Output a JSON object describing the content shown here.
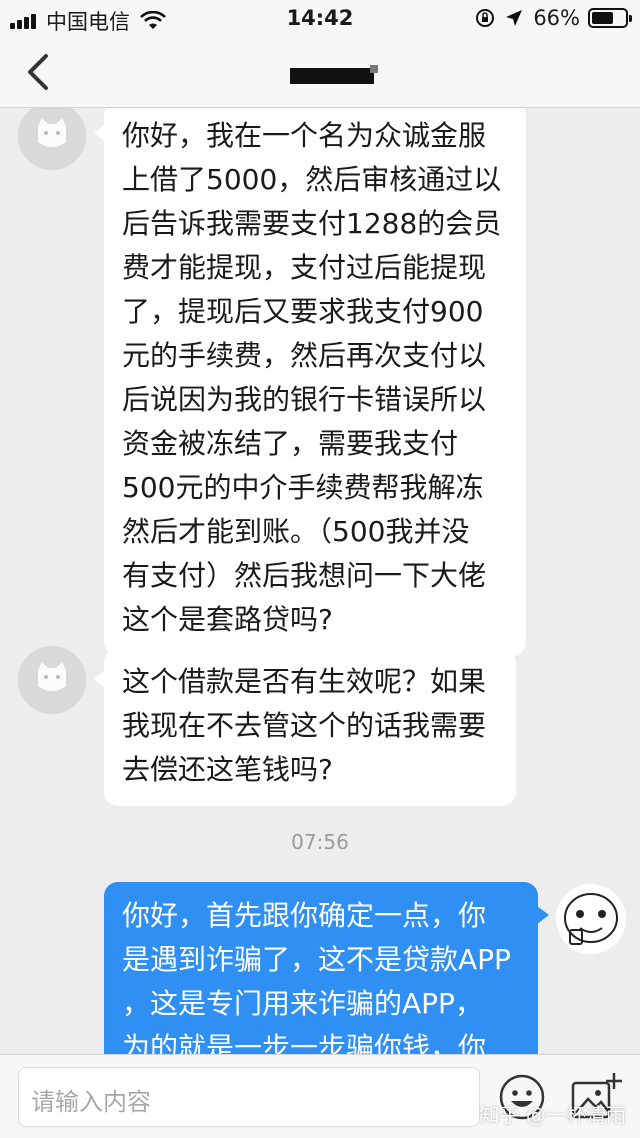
{
  "status_bar": {
    "carrier": "中国电信",
    "time": "14:42",
    "battery": "66%",
    "battery_level": 0.66
  },
  "chat": {
    "messages": [
      {
        "direction": "incoming",
        "text": "你好，我在一个名为众诚金服\n上借了5000，然后审核通过以\n后告诉我需要支付1288的会员\n费才能提现，支付过后能提现\n了，提现后又要求我支付900\n元的手续费，然后再次支付以\n后说因为我的银行卡错误所以\n资金被冻结了，需要我支付\n500元的中介手续费帮我解冻\n然后才能到账。（500我并没\n有支付）然后我想问一下大佬\n这个是套路贷吗?"
      },
      {
        "direction": "incoming",
        "text": "这个借款是否有生效呢？如果\n我现在不去管这个的话我需要\n去偿还这笔钱吗?"
      },
      {
        "direction": "outgoing",
        "text": "你好，首先跟你确定一点，你\n是遇到诈骗了，这不是贷款APP\n，这是专门用来诈骗的APP，\n为的就是一步一步骗你钱，你"
      }
    ],
    "timestamp": "07:56"
  },
  "input_bar": {
    "placeholder": "请输入内容",
    "watermark": "知乎 @一杯清雨"
  },
  "colors": {
    "background": "#ededed",
    "outgoing_bubble": "#2f8ff2",
    "incoming_bubble": "#ffffff"
  }
}
